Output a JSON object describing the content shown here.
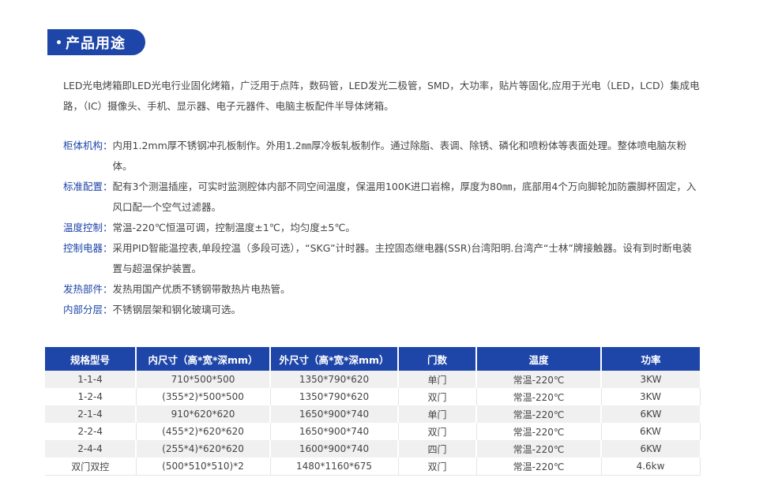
{
  "section": {
    "title": "产品用途"
  },
  "intro": "LED光电烤箱即LED光电行业固化烤箱，广泛用于点阵，数码管，LED发光二极管，SMD，大功率，贴片等固化,应用于光电（LED，LCD）集成电路，（IC）摄像头、手机、显示器、电子元器件、电脑主板配件半导体烤箱。",
  "specs": [
    {
      "label": "柜体机构：",
      "text": "内用1.2mm厚不锈钢冲孔板制作。外用1.2㎜厚冷板轧板制作。通过除脂、表调、除锈、磷化和喷粉体等表面处理。整体喷电脑灰粉体。"
    },
    {
      "label": "标准配置：",
      "text": "配有3个测温插座，可实时监测腔体内部不同空间温度，保温用100K进口岩棉，厚度为80㎜，底部用4个万向脚轮加防震脚杯固定，入风口配一个空气过滤器。"
    },
    {
      "label": "温度控制：",
      "text": "常温-220℃恒温可调，控制温度±1℃，均匀度±5℃。"
    },
    {
      "label": "控制电器：",
      "text": "采用PID智能温控表,单段控温（多段可选），“SKG”计时器。主控固态继电器(SSR)台湾阳明.台湾产“士林”牌接触器。设有到时断电装置与超温保护装置。"
    },
    {
      "label": "发热部件：",
      "text": "发热用国产优质不锈钢带散热片电热管。"
    },
    {
      "label": "内部分层：",
      "text": "不锈钢层架和钢化玻璃可选。"
    }
  ],
  "table": {
    "headers": [
      "规格型号",
      "内尺寸（高*宽*深mm）",
      "外尺寸（高*宽*深mm）",
      "门数",
      "温度",
      "功率"
    ],
    "rows": [
      [
        "1-1-4",
        "710*500*500",
        "1350*790*620",
        "单门",
        "常温-220℃",
        "3KW"
      ],
      [
        "1-2-4",
        "(355*2)*500*500",
        "1350*790*620",
        "双门",
        "常温-220℃",
        "3KW"
      ],
      [
        "2-1-4",
        "910*620*620",
        "1650*900*740",
        "单门",
        "常温-220℃",
        "6KW"
      ],
      [
        "2-2-4",
        "(455*2)*620*620",
        "1650*900*740",
        "双门",
        "常温-220℃",
        "6KW"
      ],
      [
        "2-4-4",
        "(255*4)*620*620",
        "1600*900*740",
        "四门",
        "常温-220℃",
        "6KW"
      ],
      [
        "双门双控",
        "(500*510*510)*2",
        "1480*1160*675",
        "双门",
        "常温-220℃",
        "4.6kw"
      ]
    ]
  }
}
